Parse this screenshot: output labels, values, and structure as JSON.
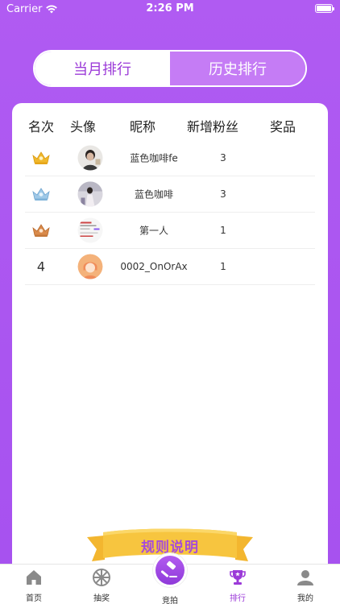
{
  "status_bar": {
    "carrier": "Carrier",
    "time": "2:26 PM"
  },
  "tabs": {
    "current_month": "当月排行",
    "history": "历史排行"
  },
  "table": {
    "headers": [
      "名次",
      "头像",
      "昵称",
      "新增粉丝",
      "奖品"
    ],
    "rows": [
      {
        "rank": "",
        "rank_icon": "gold-crown-icon",
        "name": "蓝色咖啡fe",
        "fans": "3",
        "prize": ""
      },
      {
        "rank": "",
        "rank_icon": "silver-crown-icon",
        "name": "蓝色咖啡",
        "fans": "3",
        "prize": ""
      },
      {
        "rank": "",
        "rank_icon": "bronze-crown-icon",
        "name": "第一人",
        "fans": "1",
        "prize": ""
      },
      {
        "rank": "4",
        "rank_icon": "",
        "name": "0002_OnOrAx",
        "fans": "1",
        "prize": ""
      }
    ]
  },
  "rules_banner": {
    "label": "规则说明"
  },
  "tabbar": {
    "home": "首页",
    "lottery": "抽奖",
    "auction": "竞拍",
    "ranking": "排行",
    "mine": "我的"
  },
  "colors": {
    "primary": "#a651ef",
    "accent_text": "#9b3ad8",
    "banner": "#f7c13d",
    "gold": "#f0b82c",
    "silver": "#9fc9e8",
    "bronze": "#d98a4a"
  }
}
